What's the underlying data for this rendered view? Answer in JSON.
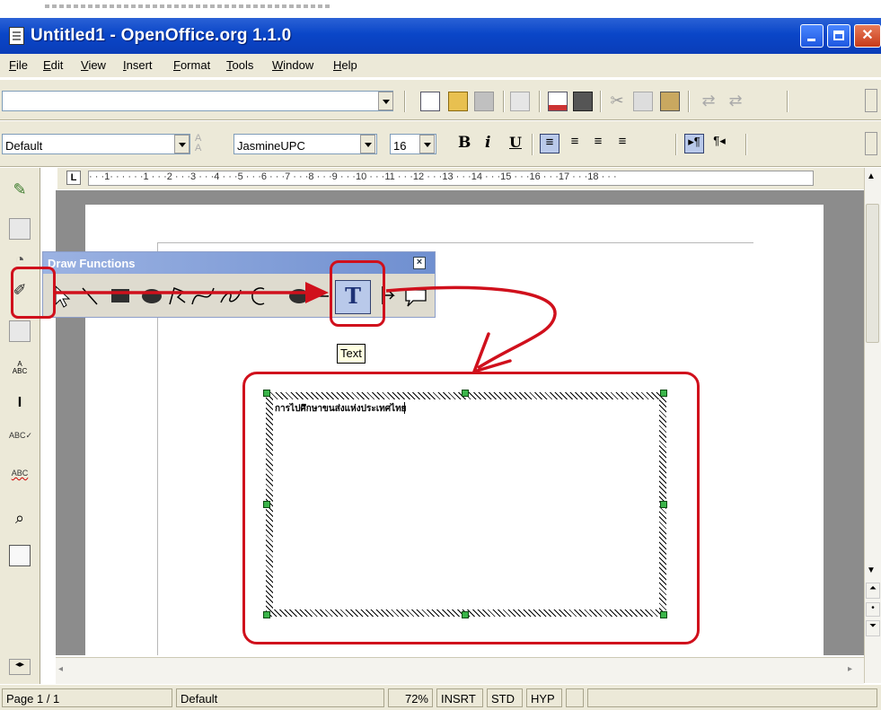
{
  "window": {
    "title": "Untitled1 - OpenOffice.org 1.1.0"
  },
  "menu": {
    "items": [
      "File",
      "Edit",
      "View",
      "Insert",
      "Format",
      "Tools",
      "Window",
      "Help"
    ]
  },
  "function_bar": {
    "url_value": ""
  },
  "object_bar": {
    "style": "Default",
    "font": "JasmineUPC",
    "size": "16",
    "bold": "B",
    "italic": "i",
    "underline": "U"
  },
  "ruler": {
    "labels": "· · ·1· · ·   · · ·1 · · ·2 · · ·3 · · ·4 · · ·5 · · ·6 · · ·7 · · ·8 · · ·9 · · ·10 · · ·11 · · ·12 · · ·13 · · ·14 · · ·15 · · ·16 · · ·17 · · ·18 · · ·"
  },
  "draw_functions": {
    "title": "Draw Functions",
    "text_tool": "T",
    "tooltip": "Text"
  },
  "document": {
    "text_frame_content": "การไปศึกษาขนส่งแห่งประเทศไทย"
  },
  "status": {
    "page": "Page 1 / 1",
    "style": "Default",
    "zoom": "72%",
    "insert": "INSRT",
    "std": "STD",
    "hyp": "HYP"
  },
  "colors": {
    "titlebar": "#0a46c8",
    "annotation": "#d0101c",
    "handles": "#3bb54a"
  }
}
